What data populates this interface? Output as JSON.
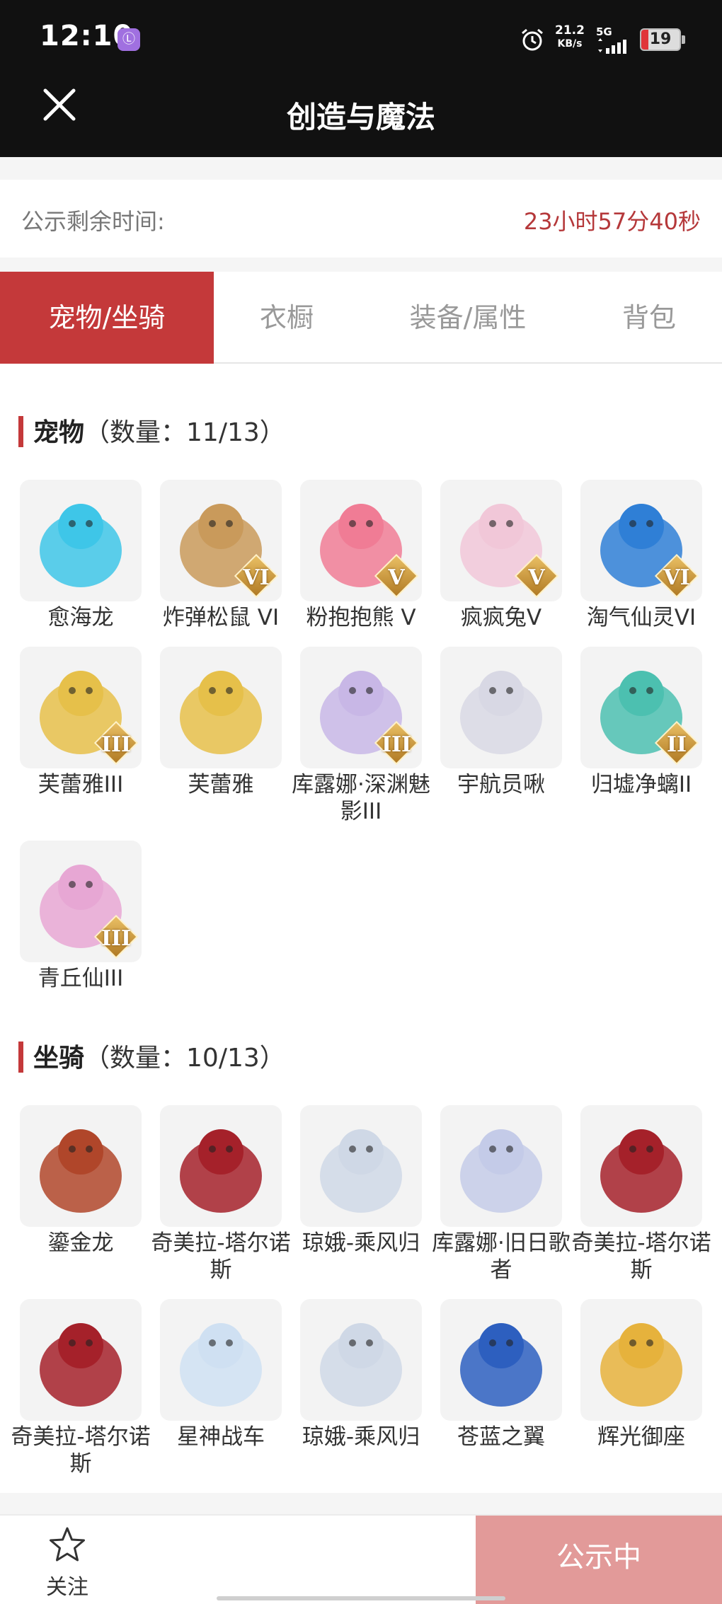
{
  "status_bar": {
    "time": "12:10",
    "app_icon_glyph": "Ⓛ",
    "net_speed_top": "21.2",
    "net_speed_bottom": "KB/s",
    "network": "5G",
    "battery": "19"
  },
  "header": {
    "title": "创造与魔法",
    "close_icon": "close-icon"
  },
  "notice": {
    "label": "公示剩余时间:",
    "remaining": "23小时57分40秒"
  },
  "tabs": [
    {
      "label": "宠物/坐骑",
      "active": true
    },
    {
      "label": "衣橱",
      "active": false
    },
    {
      "label": "装备/属性",
      "active": false
    },
    {
      "label": "背包",
      "active": false
    }
  ],
  "pets": {
    "title": "宠物",
    "count": "（数量：11/13）",
    "items": [
      {
        "name": "愈海龙",
        "badge": "",
        "color": "#3ec6e8"
      },
      {
        "name": "炸弹松鼠 VI",
        "badge": "VI",
        "color": "#c99a5b"
      },
      {
        "name": "粉抱抱熊 V",
        "badge": "V",
        "color": "#f07c95"
      },
      {
        "name": "疯疯兔V",
        "badge": "V",
        "color": "#f1c7d8"
      },
      {
        "name": "淘气仙灵VI",
        "badge": "VI",
        "color": "#2f7fd6"
      },
      {
        "name": "芙蕾雅III",
        "badge": "III",
        "color": "#e6c04a"
      },
      {
        "name": "芙蕾雅",
        "badge": "",
        "color": "#e6c04a"
      },
      {
        "name": "库露娜·深渊魅影III",
        "badge": "III",
        "color": "#c8b7e6"
      },
      {
        "name": "宇航员啾",
        "badge": "",
        "color": "#d8d8e4"
      },
      {
        "name": "归墟净螭II",
        "badge": "II",
        "color": "#4cc0b0"
      },
      {
        "name": "青丘仙III",
        "badge": "III",
        "color": "#e7a7d4"
      }
    ]
  },
  "mounts": {
    "title": "坐骑",
    "count": "（数量：10/13）",
    "items": [
      {
        "name": "鎏金龙",
        "color": "#b0462a"
      },
      {
        "name": "奇美拉-塔尔诺斯",
        "color": "#a5212a"
      },
      {
        "name": "琼娥-乘风归",
        "color": "#cfd8e6"
      },
      {
        "name": "库露娜·旧日歌者",
        "color": "#c4cbe8"
      },
      {
        "name": "奇美拉-塔尔诺斯",
        "color": "#a5212a"
      },
      {
        "name": "奇美拉-塔尔诺斯",
        "color": "#a5212a"
      },
      {
        "name": "星神战车",
        "color": "#cfe0f2"
      },
      {
        "name": "琼娥-乘风归",
        "color": "#cfd8e6"
      },
      {
        "name": "苍蓝之翼",
        "color": "#2d5fbf"
      },
      {
        "name": "辉光御座",
        "color": "#e6b23c"
      }
    ]
  },
  "bottom": {
    "follow_label": "关注",
    "status_label": "公示中"
  }
}
